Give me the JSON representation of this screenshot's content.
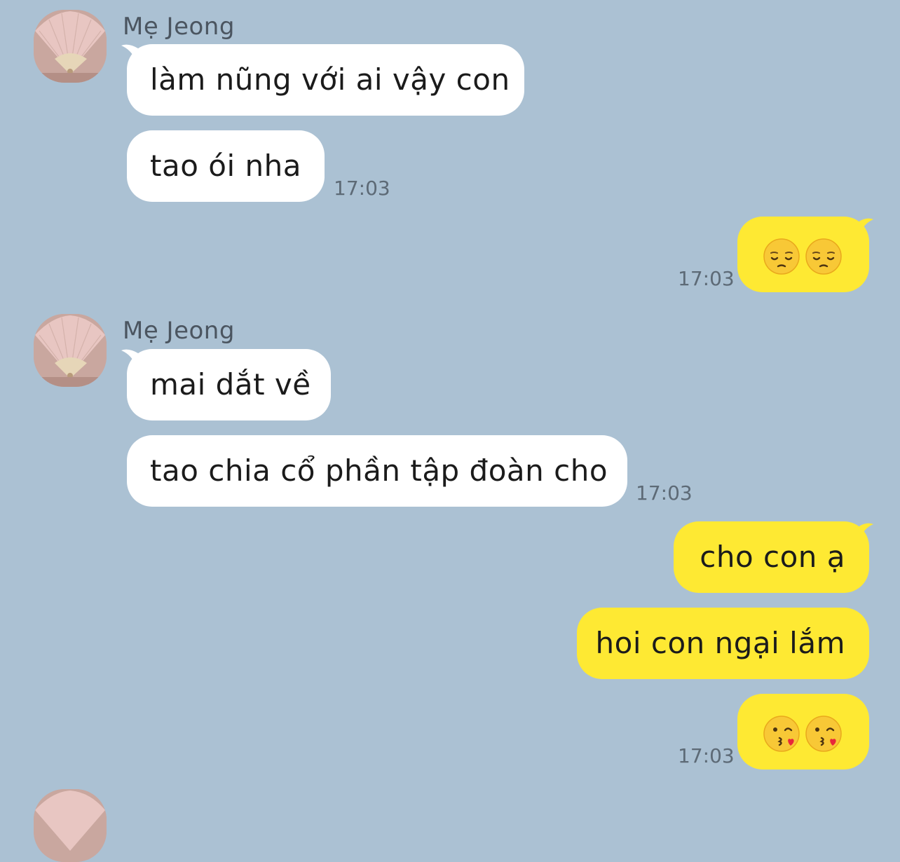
{
  "conversation": {
    "contact_name": "Mẹ Jeong",
    "group1": {
      "sender": "Mẹ Jeong",
      "msg1": "làm nũng với ai vậy con",
      "msg2": "tao ói nha",
      "time": "17:03"
    },
    "reply1": {
      "emoji": [
        "pensive-face",
        "pensive-face"
      ],
      "time": "17:03"
    },
    "group2": {
      "sender": "Mẹ Jeong",
      "msg1": "mai dắt về",
      "msg2": "tao chia cổ phần tập đoàn cho",
      "time": "17:03"
    },
    "reply2": {
      "msg1": "cho con ạ",
      "msg2": "hoi con ngại lắm",
      "emoji": [
        "face-blowing-a-kiss",
        "face-blowing-a-kiss"
      ],
      "time": "17:03"
    }
  },
  "colors": {
    "background": "#abc1d3",
    "incoming_bubble": "#ffffff",
    "outgoing_bubble": "#fee933",
    "timestamp": "#5d6a76"
  }
}
